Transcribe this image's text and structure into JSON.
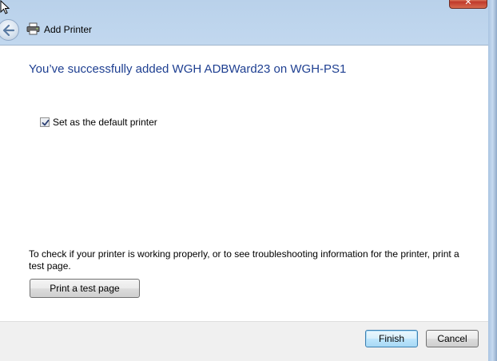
{
  "window": {
    "title": "Add Printer",
    "close_label": "✕"
  },
  "header": {
    "back_icon": "back-arrow-icon",
    "printer_icon": "printer-icon",
    "title": "Add Printer"
  },
  "main": {
    "heading": "You’ve successfully added WGH ADBWard23 on WGH-PS1",
    "default_printer": {
      "label": "Set as the default printer",
      "checked": true
    },
    "info_text": "To check if your printer is working properly, or to see troubleshooting information for the printer, print a test page.",
    "test_page_button": "Print a test page"
  },
  "footer": {
    "finish_button": "Finish",
    "cancel_button": "Cancel"
  },
  "colors": {
    "heading": "#1e3f91",
    "frame": "#bcd4ee",
    "footer": "#f0f0f0"
  }
}
